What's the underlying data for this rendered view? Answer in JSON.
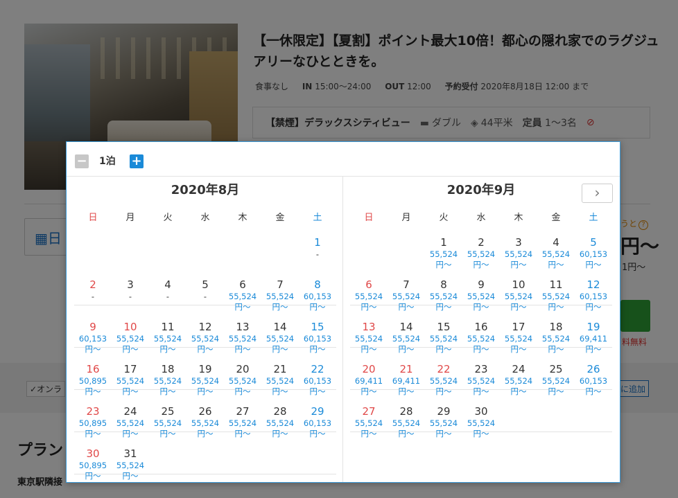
{
  "background": {
    "plan_title": "【一休限定】【夏割】ポイント最大10倍！都心の隠れ家でのラグジュアリーなひとときを。",
    "meta": {
      "meal": "食事なし",
      "in_label": "IN",
      "in_value": "15:00～24:00",
      "out_label": "OUT",
      "out_value": "12:00",
      "reserve_label": "予約受付",
      "reserve_value": "2020年8月18日 12:00 まで"
    },
    "room": {
      "name": "【禁煙】デラックスシティビュー",
      "bed": "ダブル",
      "size": "44平米",
      "capacity_label": "定員",
      "capacity_value": "1～3名"
    },
    "date_box_text": "日",
    "points_note": "うと",
    "price_big": "円～",
    "price_sub": "1円～",
    "free_note": "料無料",
    "online_chip": "✓オンラ",
    "add_button": "に追加",
    "section_title": "プラン",
    "section_sub": "東京駅隣接"
  },
  "popup": {
    "nights_label": "1泊",
    "minus_label": "−",
    "plus_label": "+",
    "next_label": "›",
    "weekdays": [
      "日",
      "月",
      "火",
      "水",
      "木",
      "金",
      "土"
    ],
    "months": [
      {
        "title": "2020年8月",
        "days": [
          {
            "d": "",
            "p": ""
          },
          {
            "d": "",
            "p": ""
          },
          {
            "d": "",
            "p": ""
          },
          {
            "d": "",
            "p": ""
          },
          {
            "d": "",
            "p": ""
          },
          {
            "d": "",
            "p": ""
          },
          {
            "d": "1",
            "p": "-"
          },
          {
            "d": "2",
            "p": "-"
          },
          {
            "d": "3",
            "p": "-"
          },
          {
            "d": "4",
            "p": "-"
          },
          {
            "d": "5",
            "p": "-"
          },
          {
            "d": "6",
            "p": "55,524円～"
          },
          {
            "d": "7",
            "p": "55,524円～"
          },
          {
            "d": "8",
            "p": "60,153円～"
          },
          {
            "d": "9",
            "p": "60,153円～",
            "holiday": true
          },
          {
            "d": "10",
            "p": "55,524円～",
            "holiday": true
          },
          {
            "d": "11",
            "p": "55,524円～"
          },
          {
            "d": "12",
            "p": "55,524円～"
          },
          {
            "d": "13",
            "p": "55,524円～"
          },
          {
            "d": "14",
            "p": "55,524円～"
          },
          {
            "d": "15",
            "p": "60,153円～"
          },
          {
            "d": "16",
            "p": "50,895円～"
          },
          {
            "d": "17",
            "p": "55,524円～"
          },
          {
            "d": "18",
            "p": "55,524円～"
          },
          {
            "d": "19",
            "p": "55,524円～"
          },
          {
            "d": "20",
            "p": "55,524円～"
          },
          {
            "d": "21",
            "p": "55,524円～"
          },
          {
            "d": "22",
            "p": "60,153円～"
          },
          {
            "d": "23",
            "p": "50,895円～"
          },
          {
            "d": "24",
            "p": "55,524円～"
          },
          {
            "d": "25",
            "p": "55,524円～"
          },
          {
            "d": "26",
            "p": "55,524円～"
          },
          {
            "d": "27",
            "p": "55,524円～"
          },
          {
            "d": "28",
            "p": "55,524円～"
          },
          {
            "d": "29",
            "p": "60,153円～"
          },
          {
            "d": "30",
            "p": "50,895円～"
          },
          {
            "d": "31",
            "p": "55,524円～"
          }
        ]
      },
      {
        "title": "2020年9月",
        "days": [
          {
            "d": "",
            "p": ""
          },
          {
            "d": "",
            "p": ""
          },
          {
            "d": "1",
            "p": "55,524円～"
          },
          {
            "d": "2",
            "p": "55,524円～"
          },
          {
            "d": "3",
            "p": "55,524円～"
          },
          {
            "d": "4",
            "p": "55,524円～"
          },
          {
            "d": "5",
            "p": "60,153円～"
          },
          {
            "d": "6",
            "p": "55,524円～"
          },
          {
            "d": "7",
            "p": "55,524円～"
          },
          {
            "d": "8",
            "p": "55,524円～"
          },
          {
            "d": "9",
            "p": "55,524円～"
          },
          {
            "d": "10",
            "p": "55,524円～"
          },
          {
            "d": "11",
            "p": "55,524円～"
          },
          {
            "d": "12",
            "p": "60,153円～"
          },
          {
            "d": "13",
            "p": "55,524円～"
          },
          {
            "d": "14",
            "p": "55,524円～"
          },
          {
            "d": "15",
            "p": "55,524円～"
          },
          {
            "d": "16",
            "p": "55,524円～"
          },
          {
            "d": "17",
            "p": "55,524円～"
          },
          {
            "d": "18",
            "p": "55,524円～"
          },
          {
            "d": "19",
            "p": "69,411円～"
          },
          {
            "d": "20",
            "p": "69,411円～"
          },
          {
            "d": "21",
            "p": "69,411円～",
            "holiday": true
          },
          {
            "d": "22",
            "p": "55,524円～",
            "holiday": true
          },
          {
            "d": "23",
            "p": "55,524円～"
          },
          {
            "d": "24",
            "p": "55,524円～"
          },
          {
            "d": "25",
            "p": "55,524円～"
          },
          {
            "d": "26",
            "p": "60,153円～"
          },
          {
            "d": "27",
            "p": "55,524円～"
          },
          {
            "d": "28",
            "p": "55,524円～"
          },
          {
            "d": "29",
            "p": "55,524円～"
          },
          {
            "d": "30",
            "p": "55,524円～"
          }
        ]
      }
    ]
  },
  "colors": {
    "accent": "#1a8ad8",
    "sunday": "#e04848",
    "saturday": "#1a8ad8",
    "popup_border": "#3a9ad9"
  }
}
